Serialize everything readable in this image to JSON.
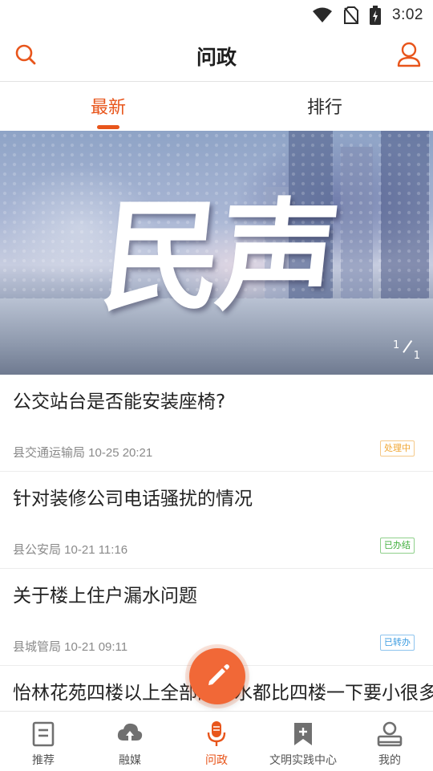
{
  "status_bar": {
    "time": "3:02",
    "icons": [
      "wifi-icon",
      "no-sim-icon",
      "battery-charging-icon"
    ]
  },
  "header": {
    "title": "问政",
    "left_icon": "search-icon",
    "right_icon": "user-icon"
  },
  "tabs": [
    {
      "label": "最新",
      "active": true
    },
    {
      "label": "排行",
      "active": false
    }
  ],
  "banner": {
    "text": "民声",
    "page_current": "1",
    "page_total": "1"
  },
  "items": [
    {
      "title": "公交站台是否能安装座椅?",
      "meta": "县交通运输局 10-25 20:21",
      "status": "处理中",
      "status_color": "#f0a531"
    },
    {
      "title": "针对装修公司电话骚扰的情况",
      "meta": "县公安局 10-21 11:16",
      "status": "已办结",
      "status_color": "#3fae3b"
    },
    {
      "title": "关于楼上住户漏水问题",
      "meta": "县城管局 10-21 09:11",
      "status": "已转办",
      "status_color": "#3a9be0"
    },
    {
      "title": "怡林花苑四楼以上全部的用水都比四楼一下要小很多",
      "meta": "",
      "status": "",
      "status_color": ""
    }
  ],
  "fab": {
    "icon": "pencil-icon",
    "color": "#f16837"
  },
  "bottom_nav": [
    {
      "label": "推荐",
      "icon": "article-icon",
      "active": false
    },
    {
      "label": "融媒",
      "icon": "cloud-upload-icon",
      "active": false
    },
    {
      "label": "问政",
      "icon": "microphone-icon",
      "active": true
    },
    {
      "label": "文明实践中心",
      "icon": "bookmark-plus-icon",
      "active": false
    },
    {
      "label": "我的",
      "icon": "profile-icon",
      "active": false
    }
  ],
  "colors": {
    "accent": "#e8551b",
    "text": "#222222",
    "muted": "#8a8a8a"
  }
}
